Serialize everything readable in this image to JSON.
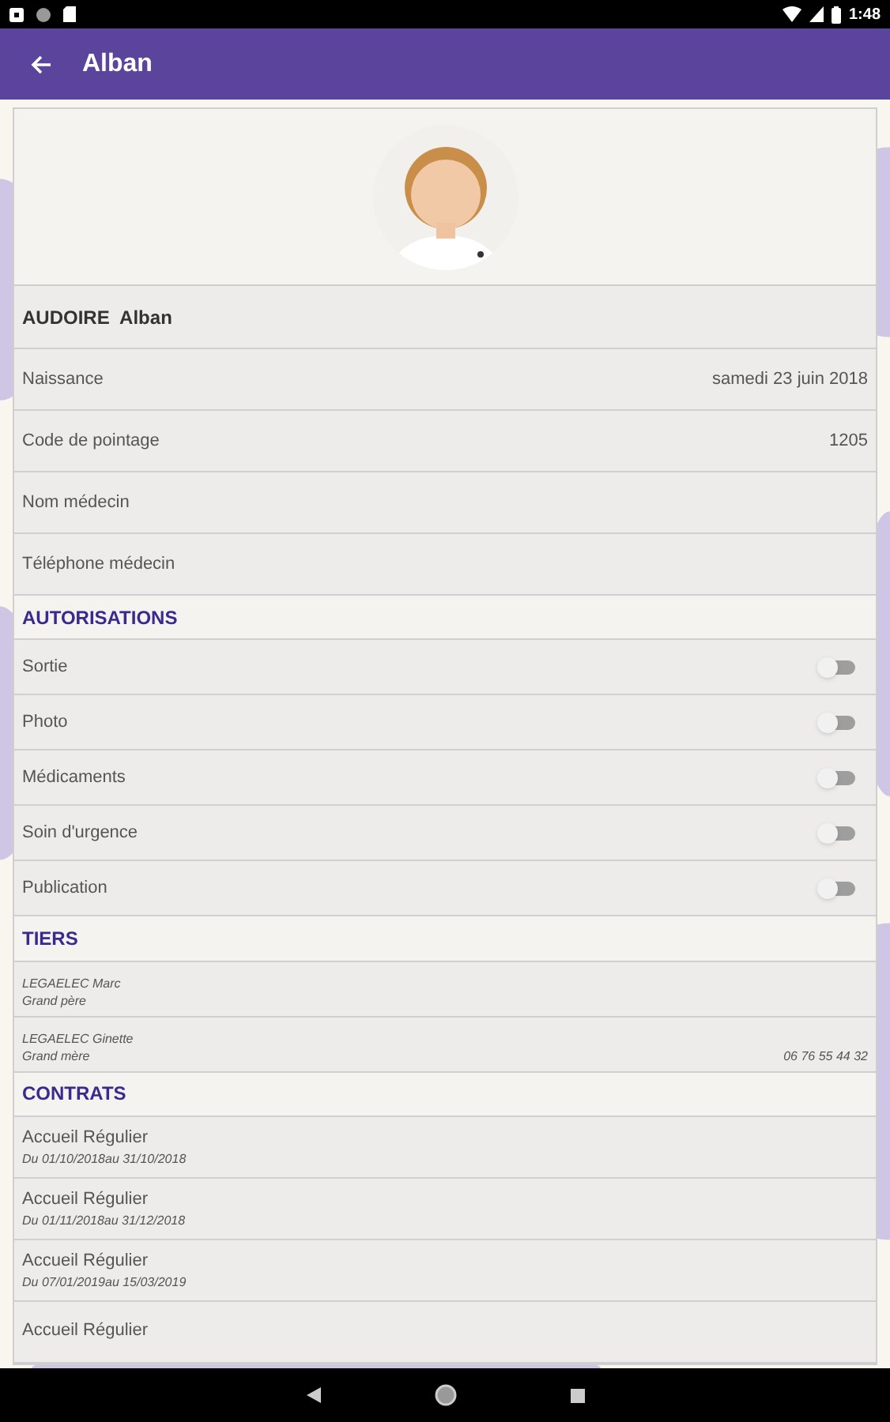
{
  "status_bar": {
    "time": "1:48"
  },
  "app_bar": {
    "title": "Alban"
  },
  "profile": {
    "name": "AUDOIRE  Alban"
  },
  "fields": [
    {
      "label": "Naissance",
      "value": "samedi 23 juin 2018"
    },
    {
      "label": "Code de pointage",
      "value": "1205"
    },
    {
      "label": "Nom médecin"
    },
    {
      "label": "Téléphone médecin"
    }
  ],
  "autorisations": {
    "title": "AUTORISATIONS",
    "items": [
      {
        "label": "Sortie",
        "on": false
      },
      {
        "label": "Photo",
        "on": false
      },
      {
        "label": "Médicaments",
        "on": false
      },
      {
        "label": "Soin d'urgence",
        "on": false
      },
      {
        "label": "Publication",
        "on": false
      }
    ]
  },
  "tiers": {
    "title": "TIERS",
    "items": [
      {
        "name": "LEGAELEC Marc",
        "relation": "Grand père"
      },
      {
        "name": "LEGAELEC Ginette",
        "relation": "Grand mère",
        "phone": "06 76 55 44 32"
      }
    ]
  },
  "contrats": {
    "title": "CONTRATS",
    "items": [
      {
        "type": "Accueil Régulier",
        "period": "Du 01/10/2018au 31/10/2018"
      },
      {
        "type": "Accueil Régulier",
        "period": "Du 01/11/2018au 31/12/2018"
      },
      {
        "type": "Accueil Régulier",
        "period": "Du 07/01/2019au 15/03/2019"
      },
      {
        "type": "Accueil Régulier"
      }
    ]
  }
}
